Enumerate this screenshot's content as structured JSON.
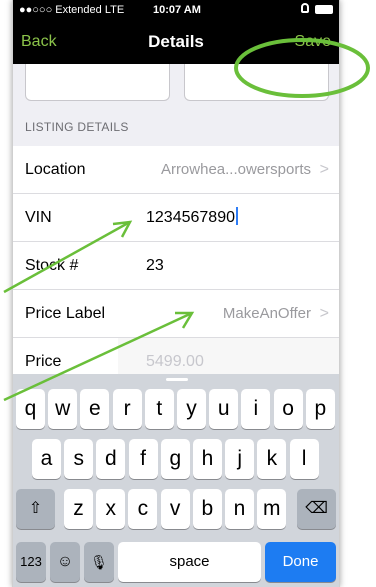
{
  "status_bar": {
    "carrier": "●●○○○ Extended  LTE",
    "time": "10:07 AM"
  },
  "navbar": {
    "back_label": "Back",
    "title": "Details",
    "save_label": "Save"
  },
  "section": {
    "header": "LISTING DETAILS"
  },
  "rows": {
    "location": {
      "label": "Location",
      "value": "Arrowhea...owersports"
    },
    "vin": {
      "label": "VIN",
      "value": "1234567890"
    },
    "stock": {
      "label": "Stock #",
      "value": "23"
    },
    "price_label": {
      "label": "Price Label",
      "value": "MakeAnOffer"
    },
    "price": {
      "label": "Price",
      "placeholder": "5499.00"
    }
  },
  "keyboard": {
    "row1": [
      "q",
      "w",
      "e",
      "r",
      "t",
      "y",
      "u",
      "i",
      "o",
      "p"
    ],
    "row2": [
      "a",
      "s",
      "d",
      "f",
      "g",
      "h",
      "j",
      "k",
      "l"
    ],
    "row3": [
      "z",
      "x",
      "c",
      "v",
      "b",
      "n",
      "m"
    ],
    "shift_icon": "⇧",
    "delete_icon": "⌫",
    "numbers_label": "123",
    "emoji_icon": "☺",
    "mic_icon": "🎙",
    "space_label": "space",
    "done_label": "Done"
  },
  "colors": {
    "accent": "#8bc34a",
    "annotation": "#6abf3a",
    "done": "#1d7cf2"
  }
}
